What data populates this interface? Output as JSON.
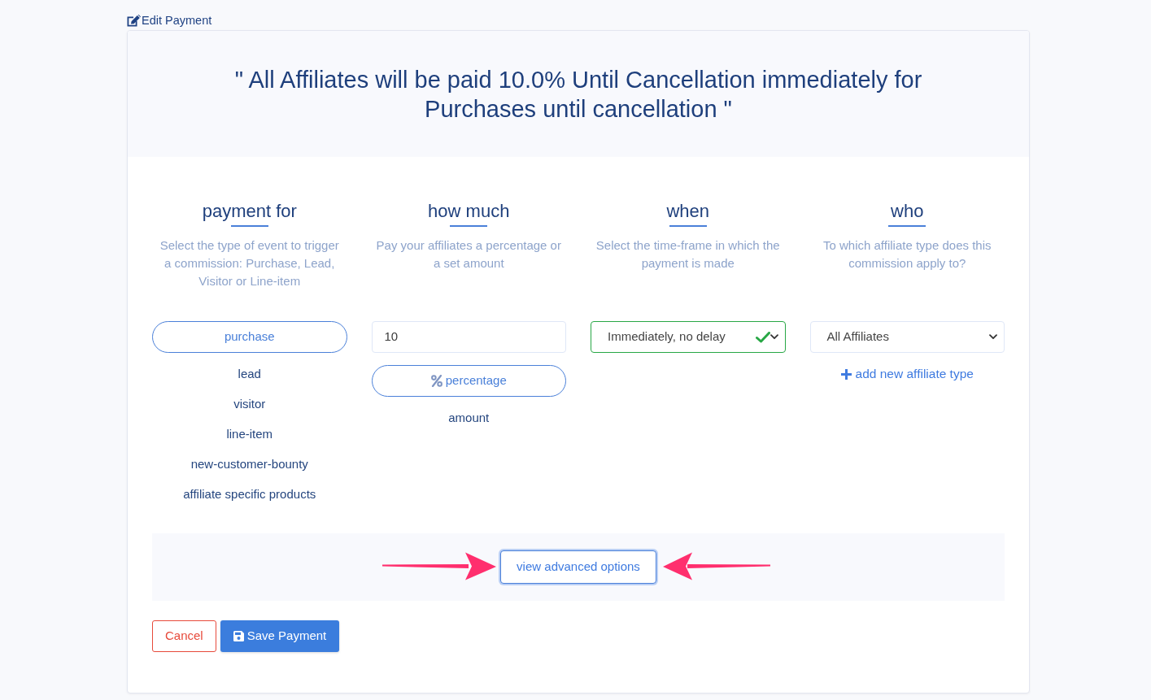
{
  "header": {
    "title": "Edit Payment"
  },
  "summary": "\" All Affiliates will be paid 10.0% Until Cancellation immediately for Purchases until cancellation \"",
  "sections": [
    {
      "kind": "options",
      "heading": "payment for",
      "description": "Select the type of event to trigger a commission: Purchase, Lead, Visitor or Line-item",
      "options": [
        {
          "label": "purchase",
          "selected": true
        },
        {
          "label": "lead",
          "selected": false
        },
        {
          "label": "visitor",
          "selected": false
        },
        {
          "label": "line-item",
          "selected": false
        },
        {
          "label": "new-customer-bounty",
          "selected": false
        },
        {
          "label": "affiliate specific products",
          "selected": false
        }
      ]
    },
    {
      "kind": "amount",
      "heading": "how much",
      "description": "Pay your affiliates a percentage or a set amount",
      "value": "10",
      "options": [
        {
          "kind": "percentage",
          "label": "percentage",
          "selected": true
        },
        {
          "kind": "amount",
          "label": "amount",
          "selected": false
        }
      ]
    },
    {
      "kind": "select",
      "heading": "when",
      "description": "Select the time-frame in which the payment is made",
      "select": {
        "value": "Immediately, no delay",
        "valid": true
      }
    },
    {
      "kind": "select",
      "heading": "who",
      "description": "To which affiliate type does this commission apply to?",
      "select": {
        "value": "All Affiliates"
      },
      "link": "add new affiliate type"
    }
  ],
  "advanced": {
    "label": "view advanced options",
    "focused": true,
    "callout_arrows": true
  },
  "actions": [
    {
      "kind": "cancel",
      "label": "Cancel"
    },
    {
      "kind": "save",
      "label": "Save Payment"
    }
  ]
}
